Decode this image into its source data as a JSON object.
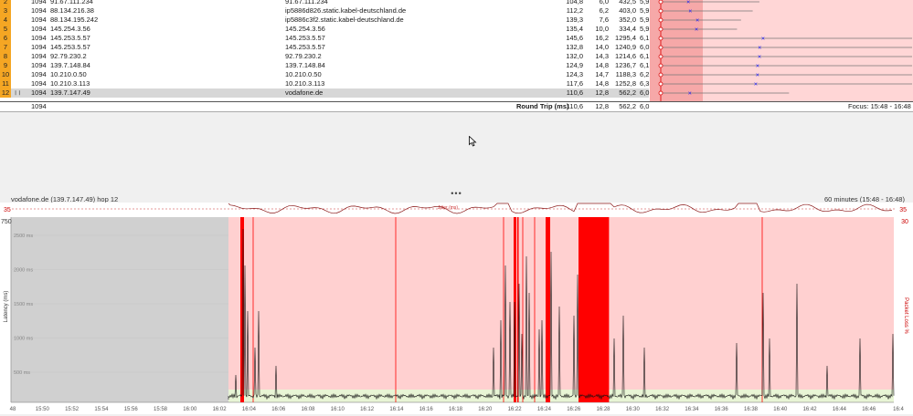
{
  "hops": [
    {
      "hop": "2",
      "count": "1094",
      "ip": "91.67.111.234",
      "name": "91.67.111.234",
      "avg": "104,8",
      "min": "6,0",
      "cur": "432,5",
      "pl": "5,9"
    },
    {
      "hop": "3",
      "count": "1094",
      "ip": "88.134.216.38",
      "name": "ip5886d826.static.kabel-deutschland.de",
      "avg": "112,2",
      "min": "6,2",
      "cur": "403,0",
      "pl": "5,9"
    },
    {
      "hop": "4",
      "count": "1094",
      "ip": "88.134.195.242",
      "name": "ip5886c3f2.static.kabel-deutschland.de",
      "avg": "139,3",
      "min": "7,6",
      "cur": "352,0",
      "pl": "5,9"
    },
    {
      "hop": "5",
      "count": "1094",
      "ip": "145.254.3.56",
      "name": "145.254.3.56",
      "avg": "135,4",
      "min": "10,0",
      "cur": "334,4",
      "pl": "5,9"
    },
    {
      "hop": "6",
      "count": "1094",
      "ip": "145.253.5.57",
      "name": "145.253.5.57",
      "avg": "145,6",
      "min": "16,2",
      "cur": "1295,4",
      "pl": "6,1"
    },
    {
      "hop": "7",
      "count": "1094",
      "ip": "145.253.5.57",
      "name": "145.253.5.57",
      "avg": "132,8",
      "min": "14,0",
      "cur": "1240,9",
      "pl": "6,0"
    },
    {
      "hop": "8",
      "count": "1094",
      "ip": "92.79.230.2",
      "name": "92.79.230.2",
      "avg": "132,0",
      "min": "14,3",
      "cur": "1214,6",
      "pl": "6,1"
    },
    {
      "hop": "9",
      "count": "1094",
      "ip": "139.7.148.84",
      "name": "139.7.148.84",
      "avg": "124,9",
      "min": "14,8",
      "cur": "1236,7",
      "pl": "6,1"
    },
    {
      "hop": "10",
      "count": "1094",
      "ip": "10.210.0.50",
      "name": "10.210.0.50",
      "avg": "124,3",
      "min": "14,7",
      "cur": "1188,3",
      "pl": "6,2"
    },
    {
      "hop": "11",
      "count": "1094",
      "ip": "10.210.3.113",
      "name": "10.210.3.113",
      "avg": "117,6",
      "min": "14,8",
      "cur": "1252,8",
      "pl": "6,3"
    },
    {
      "hop": "12",
      "count": "1094",
      "ip": "139.7.147.49",
      "name": "vodafone.de",
      "avg": "110,6",
      "min": "12,8",
      "cur": "562,2",
      "pl": "6,0"
    }
  ],
  "footer": {
    "count": "1094",
    "label": "Round Trip (ms)",
    "avg": "110,6",
    "min": "12,8",
    "cur": "562,2",
    "pl": "6,0",
    "focus": "Focus: 15:48 - 16:48"
  },
  "graph": {
    "title": "vodafone.de (139.7.147.49) hop 12",
    "range": "60 minutes (15:48 - 16:48)",
    "jitter_label": "Jitter (ms)",
    "jitter_max": "35",
    "latency_max": "750",
    "loss_max": "30",
    "ylabel": "Latency (ms)",
    "y2label": "Packet Loss %",
    "yticks": [
      "2500 ms",
      "2000 ms",
      "1500 ms",
      "1000 ms",
      "500 ms"
    ],
    "xticks": [
      "48",
      "15:50",
      "15:52",
      "15:54",
      "15:56",
      "15:58",
      "16:00",
      "16:02",
      "16:04",
      "16:06",
      "16:08",
      "16:10",
      "16:12",
      "16:14",
      "16:16",
      "16:18",
      "16:20",
      "16:22",
      "16:24",
      "16:26",
      "16:28",
      "16:30",
      "16:32",
      "16:34",
      "16:36",
      "16:38",
      "16:40",
      "16:42",
      "16:44",
      "16:46",
      "16:4"
    ]
  },
  "colors": {
    "hop": "#f5a623",
    "loss_bg": "#ffd0d0",
    "loss": "#ff0000",
    "gray": "#d0d0d0",
    "line": "#111111",
    "green": "#e8f5d5"
  }
}
